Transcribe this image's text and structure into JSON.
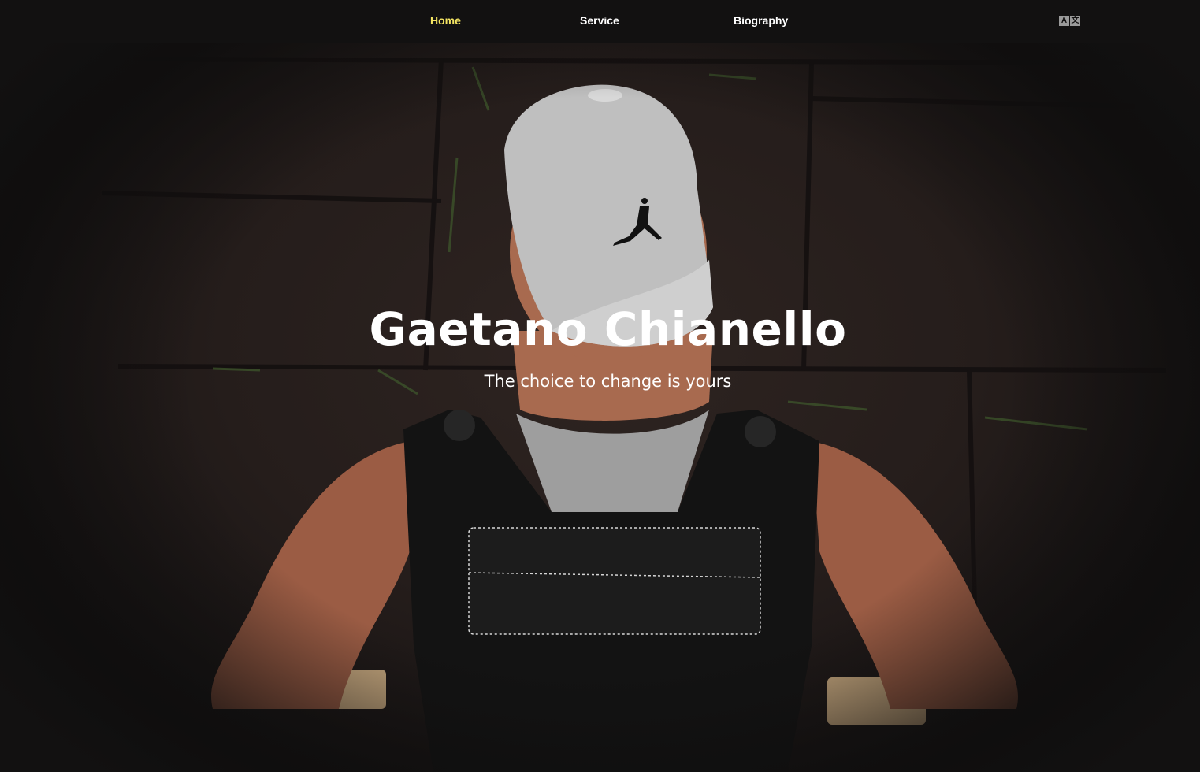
{
  "nav": {
    "items": [
      {
        "label": "Home",
        "active": true
      },
      {
        "label": "Service",
        "active": false
      },
      {
        "label": "Biography",
        "active": false
      }
    ],
    "language_icon": "translate-icon",
    "language_glyphs": [
      "A",
      "文"
    ]
  },
  "hero": {
    "title": "Gaetano Chianello",
    "subtitle": "The choice to change is yours",
    "background_image": "man-in-white-cap-and-weight-vest-photo"
  },
  "colors": {
    "background": "#121111",
    "nav_active": "#f5e663",
    "nav_text": "#ffffff",
    "title_text": "#ffffff"
  }
}
